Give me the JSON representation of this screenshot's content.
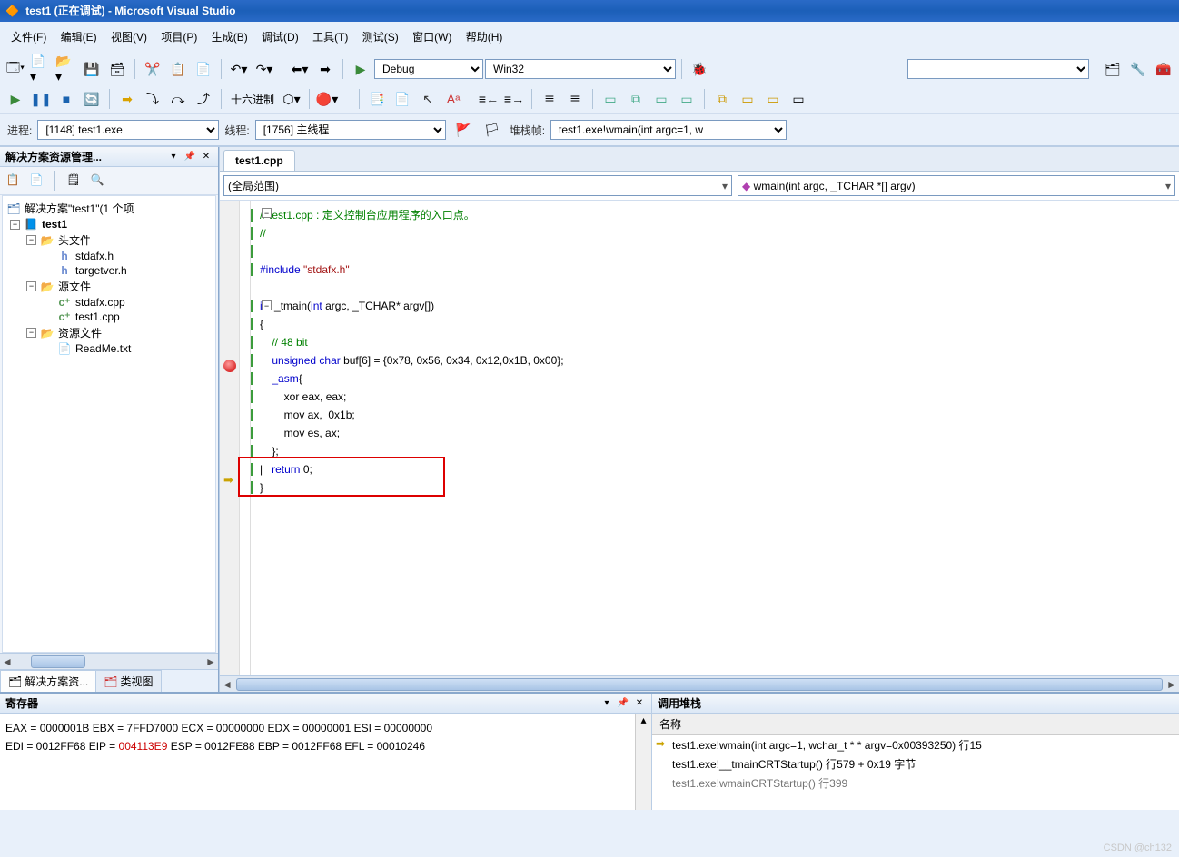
{
  "title": "test1 (正在调试) - Microsoft Visual Studio",
  "menu": {
    "items": [
      "文件(F)",
      "编辑(E)",
      "视图(V)",
      "项目(P)",
      "生成(B)",
      "调试(D)",
      "工具(T)",
      "测试(S)",
      "窗口(W)",
      "帮助(H)"
    ]
  },
  "toolbar1": {
    "config": "Debug",
    "platform": "Win32",
    "hex_label": "十六进制"
  },
  "debugbar": {
    "process_label": "进程:",
    "process": "[1148] test1.exe",
    "thread_label": "线程:",
    "thread": "[1756] 主线程",
    "frame_label": "堆栈帧:",
    "frame": "test1.exe!wmain(int argc=1, w"
  },
  "solution": {
    "panel_title": "解决方案资源管理...",
    "root": "解决方案\"test1\"(1 个项",
    "project": "test1",
    "folders": {
      "headers": "头文件",
      "sources": "源文件",
      "resources": "资源文件"
    },
    "headers": [
      "stdafx.h",
      "targetver.h"
    ],
    "sources": [
      "stdafx.cpp",
      "test1.cpp"
    ],
    "resources": [
      "ReadMe.txt"
    ],
    "tabs": {
      "sol": "解决方案资...",
      "cls": "类视图"
    }
  },
  "editor": {
    "tab": "test1.cpp",
    "scope": "(全局范围)",
    "func": "wmain(int argc, _TCHAR *[] argv)",
    "code": {
      "l1": "// test1.cpp : 定义控制台应用程序的入口点。",
      "l2": "//",
      "l3": "#include \"stdafx.h\"",
      "l4": "int _tmain(int argc, _TCHAR* argv[])",
      "l5": "{",
      "l6": "    // 48 bit",
      "l7": "    unsigned char buf[6] = {0x78, 0x56, 0x34, 0x12,0x1B, 0x00};",
      "l8": "    _asm{",
      "l9": "        xor eax, eax;",
      "l10": "        mov ax,  0x1b;",
      "l11": "        mov es, ax;",
      "l12": "    };",
      "l13": "|   return 0;",
      "l14": "}"
    }
  },
  "registers": {
    "title": "寄存器",
    "line1_a": "EAX = 0000001B EBX = 7FFD7000 ECX = 00000000 EDX = 00000001 ESI = 00000000",
    "line2_a": "EDI = 0012FF68 EIP = ",
    "line2_red": "004113E9",
    "line2_b": " ESP = 0012FE88 EBP = 0012FF68 EFL = 00010246"
  },
  "callstack": {
    "title": "调用堆栈",
    "header": "名称",
    "rows": [
      "test1.exe!wmain(int argc=1, wchar_t * * argv=0x00393250) 行15",
      "test1.exe!__tmainCRTStartup() 行579 + 0x19 字节",
      "test1.exe!wmainCRTStartup() 行399"
    ]
  },
  "watermark": "CSDN @ch132"
}
